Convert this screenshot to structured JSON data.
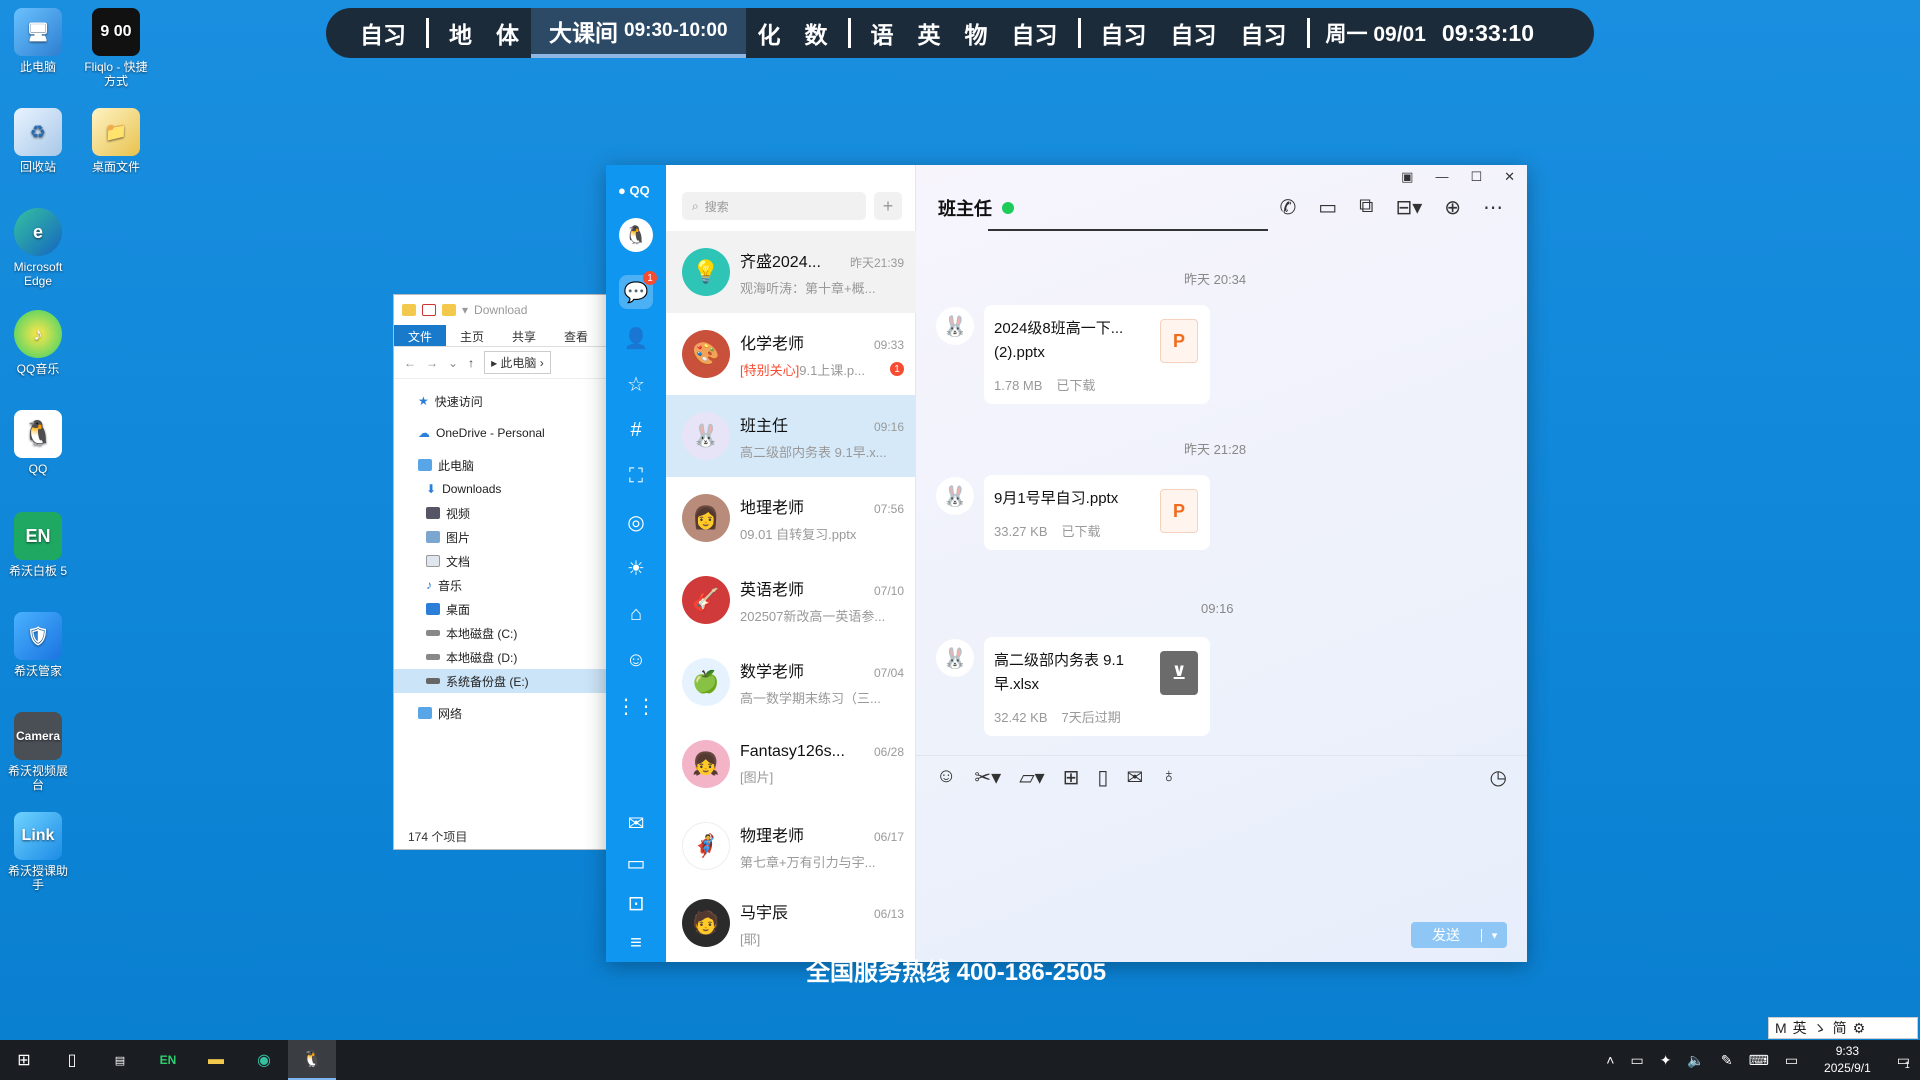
{
  "desktop_icons": [
    {
      "label": "此电脑",
      "icon": "computer-icon"
    },
    {
      "label": "Fliqlo - 快捷方式",
      "icon": "clock-icon",
      "badge": "9 00"
    },
    {
      "label": "回收站",
      "icon": "recycle-bin-icon"
    },
    {
      "label": "桌面文件",
      "icon": "folder-icon"
    },
    {
      "label": "Microsoft Edge",
      "icon": "edge-icon"
    },
    {
      "label": "QQ音乐",
      "icon": "music-icon"
    },
    {
      "label": "QQ",
      "icon": "qq-icon"
    },
    {
      "label": "希沃白板 5",
      "icon": "seewo-board-icon",
      "badge": "EN"
    },
    {
      "label": "希沃管家",
      "icon": "shield-icon"
    },
    {
      "label": "希沃视频展台",
      "icon": "camera-icon",
      "badge": "Camera"
    },
    {
      "label": "希沃授课助手",
      "icon": "link-icon",
      "badge": "Link"
    }
  ],
  "schedule": {
    "g1": [
      "自习"
    ],
    "g2": [
      "地",
      "体"
    ],
    "active": {
      "name": "大课间",
      "time": "09:30-10:00"
    },
    "g3": [
      "化",
      "数"
    ],
    "g4": [
      "语",
      "英",
      "物",
      "自习"
    ],
    "g5": [
      "自习",
      "自习",
      "自习"
    ],
    "date": "周一 09/01",
    "clock": "09:33:10"
  },
  "explorer": {
    "title": "Download",
    "ribbon": [
      "文件",
      "主页",
      "共享",
      "查看"
    ],
    "path": "此电脑",
    "tree": {
      "quick": "快速访问",
      "onedrive": "OneDrive - Personal",
      "pc": "此电脑",
      "downloads": "Downloads",
      "videos": "视频",
      "pictures": "图片",
      "docs": "文档",
      "music": "音乐",
      "desktop": "桌面",
      "c": "本地磁盘 (C:)",
      "d": "本地磁盘 (D:)",
      "e": "系统备份盘 (E:)",
      "network": "网络"
    },
    "status": "174 个项目"
  },
  "qq": {
    "logo": "QQ",
    "unread": "1",
    "search_placeholder": "搜索",
    "conversations": [
      {
        "name": "齐盛2024...",
        "time": "昨天21:39",
        "msg": "观海听涛：第十章+概...",
        "avatar": "💡"
      },
      {
        "name": "化学老师",
        "time": "09:33",
        "highlight": "[特别关心]",
        "msg": "9.1上课.p...",
        "badge": "1",
        "avatar": "🎨"
      },
      {
        "name": "班主任",
        "time": "09:16",
        "msg": "高二级部内务表 9.1早.x...",
        "avatar": "🐰"
      },
      {
        "name": "地理老师",
        "time": "07:56",
        "msg": "09.01 自转复习.pptx",
        "avatar": "👩"
      },
      {
        "name": "英语老师",
        "time": "07/10",
        "msg": "202507新改高一英语参...",
        "avatar": "🎸"
      },
      {
        "name": "数学老师",
        "time": "07/04",
        "msg": "高一数学期末练习（三...",
        "avatar": "🍏"
      },
      {
        "name": "Fantasy126s...",
        "time": "06/28",
        "msg": "[图片]",
        "avatar": "👧"
      },
      {
        "name": "物理老师",
        "time": "06/17",
        "msg": "第七章+万有引力与宇...",
        "avatar": "🦸"
      },
      {
        "name": "马宇辰",
        "time": "06/13",
        "msg": "[耶]",
        "avatar": "🧑"
      }
    ],
    "chat": {
      "title": "班主任",
      "messages": [
        {
          "stamp": "昨天 20:34",
          "file": "2024级8班高一下...(2).pptx",
          "size": "1.78 MB",
          "state": "已下载",
          "type": "P"
        },
        {
          "stamp": "昨天 21:28",
          "file": "9月1号早自习.pptx",
          "size": "33.27 KB",
          "state": "已下载",
          "type": "P"
        },
        {
          "stamp": "09:16",
          "file": "高二级部内务表 9.1早.xlsx",
          "size": "32.42 KB",
          "state": "7天后过期",
          "type": "X"
        }
      ],
      "send": "发送"
    }
  },
  "hotline": "全国服务热线 400-186-2505",
  "ime": [
    "M",
    "英",
    "ゝ",
    "简",
    "⚙"
  ],
  "taskbar": {
    "time": "9:33",
    "date": "2025/9/1",
    "notif": "1"
  }
}
